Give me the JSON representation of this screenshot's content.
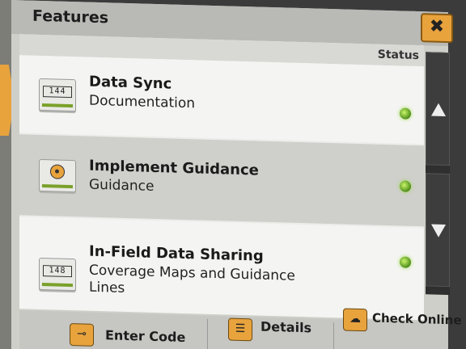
{
  "window": {
    "title": "Features",
    "close_label": "✖"
  },
  "list": {
    "status_header": "Status",
    "rows": [
      {
        "icon": "counter-icon",
        "icon_text": "144",
        "title": "Data Sync",
        "subtitle": "Documentation",
        "status": "active",
        "status_color": "#5fb82a"
      },
      {
        "icon": "guidance-target-icon",
        "title": "Implement Guidance",
        "subtitle": "Guidance",
        "status": "active",
        "status_color": "#5fb82a"
      },
      {
        "icon": "counter-icon",
        "icon_text": "148",
        "title": "In-Field Data Sharing",
        "subtitle": "Coverage Maps and Guidance Lines",
        "status": "active",
        "status_color": "#5fb82a"
      }
    ]
  },
  "scroll": {
    "up_icon": "arrow-up-icon",
    "down_icon": "arrow-down-icon"
  },
  "toolbar": {
    "enter_code_label": "Enter Code",
    "enter_code_icon": "key-icon",
    "details_label": "Details",
    "details_icon": "document-icon",
    "check_online_label": "Check Online",
    "check_online_icon": "cloud-download-icon"
  },
  "colors": {
    "accent": "#e8a33d",
    "status_green": "#5fb82a"
  }
}
